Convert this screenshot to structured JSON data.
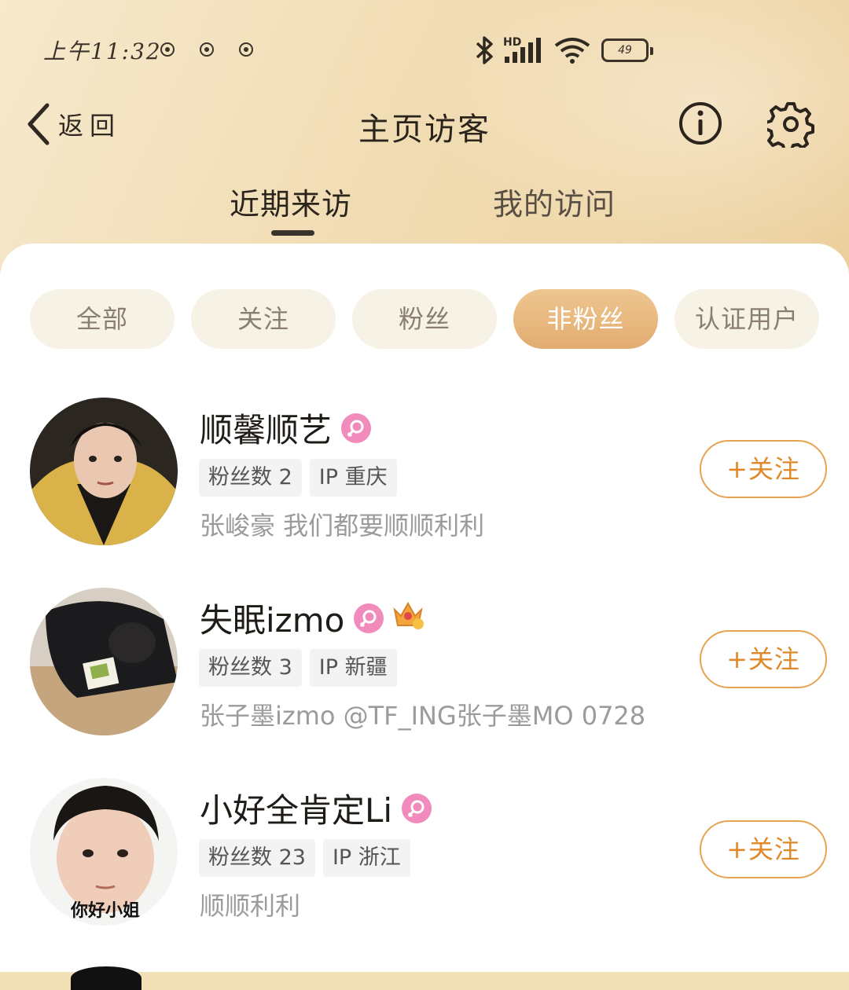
{
  "status_bar": {
    "time": "上午11:32",
    "battery": "49",
    "network": "HD"
  },
  "nav": {
    "back_label": "返回",
    "title": "主页访客"
  },
  "tabs": [
    {
      "label": "近期来访",
      "active": true
    },
    {
      "label": "我的访问",
      "active": false
    }
  ],
  "filters": [
    {
      "label": "全部",
      "active": false
    },
    {
      "label": "关注",
      "active": false
    },
    {
      "label": "粉丝",
      "active": false
    },
    {
      "label": "非粉丝",
      "active": true
    },
    {
      "label": "认证用户",
      "active": false
    }
  ],
  "visitors": [
    {
      "name": "顺馨顺艺",
      "fans": "粉丝数 2",
      "ip": "IP 重庆",
      "desc": "张峻豪 我们都要顺顺利利",
      "follow_label": "+关注"
    },
    {
      "name": "失眠izmo",
      "fans": "粉丝数 3",
      "ip": "IP 新疆",
      "desc": "张子墨izmo @TF_ING张子墨MO 0728",
      "follow_label": "+关注"
    },
    {
      "name": "小好全肯定Li",
      "fans": "粉丝数 23",
      "ip": "IP 浙江",
      "desc": "顺顺利利",
      "follow_label": "+关注",
      "avatar_caption": "你好小姐"
    }
  ],
  "colors": {
    "accent": "#e1892a",
    "chip_active": "#e6b47a",
    "female_badge": "#f08bbc"
  }
}
